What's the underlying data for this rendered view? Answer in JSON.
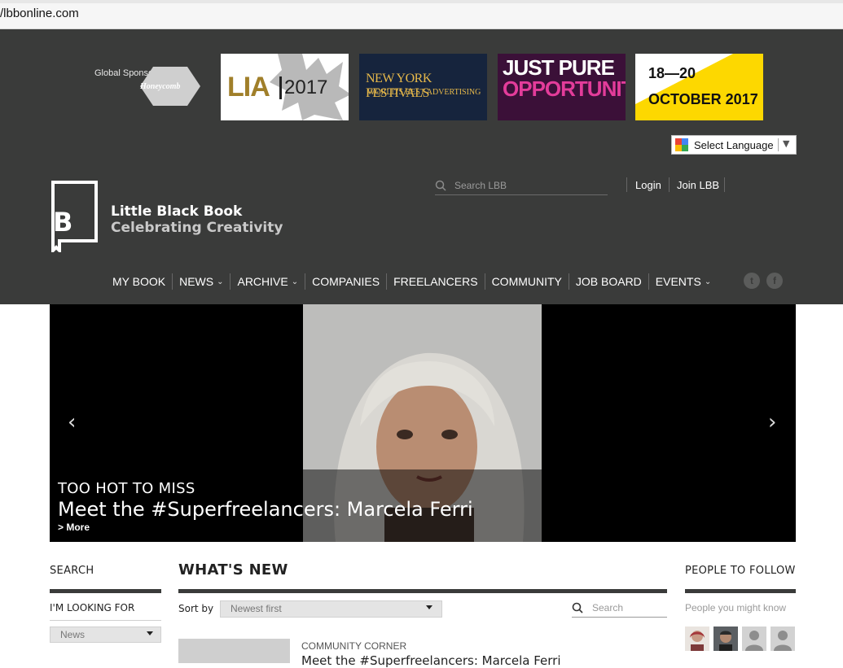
{
  "browser": {
    "url": "/lbbonline.com"
  },
  "sponsors": {
    "label": "Global Sponsors",
    "name": "Honeycomb",
    "banners": [
      {
        "text1": "LIA",
        "text2": "2017"
      },
      {
        "text1": "NEW YORK FESTIVALS",
        "text2": "WORLD'S BEST ADVERTISING"
      },
      {
        "text1": "JUST PURE",
        "text2": "OPPORTUNITY"
      },
      {
        "text1": "18—20",
        "text2": "OCTOBER 2017"
      }
    ]
  },
  "language": {
    "label": "Select Language",
    "arrow": "▼"
  },
  "brand": {
    "logo_letter": "B",
    "name": "Little Black Book",
    "tagline": "Celebrating Creativity"
  },
  "header_search": {
    "placeholder": "Search LBB"
  },
  "auth": {
    "login": "Login",
    "join": "Join LBB"
  },
  "nav": [
    {
      "label": "MY BOOK",
      "chevron": ""
    },
    {
      "label": "NEWS",
      "chevron": "⌄"
    },
    {
      "label": "ARCHIVE",
      "chevron": "⌄"
    },
    {
      "label": "COMPANIES",
      "chevron": ""
    },
    {
      "label": "FREELANCERS",
      "chevron": ""
    },
    {
      "label": "COMMUNITY",
      "chevron": ""
    },
    {
      "label": "JOB BOARD",
      "chevron": ""
    },
    {
      "label": "EVENTS",
      "chevron": "⌄"
    }
  ],
  "social": {
    "twitter": "t",
    "facebook": "f"
  },
  "hero": {
    "prev": "‹",
    "next": "›",
    "kicker": "TOO HOT TO MISS",
    "headline": "Meet the #Superfreelancers: Marcela Ferri",
    "more": "> More"
  },
  "search_panel": {
    "title": "SEARCH",
    "looking_for": "I'M LOOKING FOR",
    "select_value": "News"
  },
  "whats_new": {
    "title": "WHAT'S NEW",
    "sort_label": "Sort by",
    "sort_value": "Newest first",
    "search_placeholder": "Search",
    "article_category": "COMMUNITY CORNER",
    "article_title": "Meet the #Superfreelancers: Marcela Ferri"
  },
  "people": {
    "title": "PEOPLE TO FOLLOW",
    "subtitle": "People you might know"
  },
  "colors": {
    "header_bg": "#3a3b3a",
    "accent_pink": "#e33c9a",
    "accent_yellow": "#fdd800"
  }
}
